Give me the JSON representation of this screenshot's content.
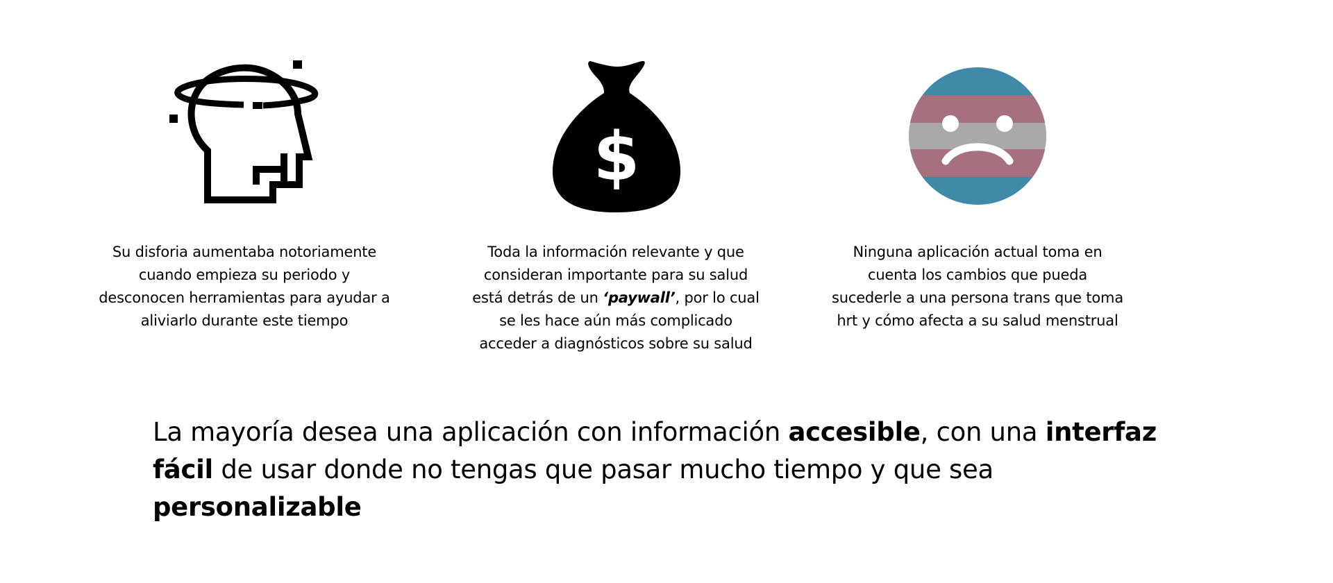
{
  "colors": {
    "text": "#000000",
    "background": "#ffffff",
    "trans_blue": "#3f8aa8",
    "trans_pink": "#a6707e",
    "trans_gray": "#a9a9a9"
  },
  "icons": [
    {
      "name": "head-dysphoria-icon"
    },
    {
      "name": "money-bag-icon"
    },
    {
      "name": "sad-face-trans-flag-icon"
    }
  ],
  "captions": {
    "first": "Su disforia aumentaba notoriamente cuando empieza su periodo y desconocen herramientas para ayudar a aliviarlo durante este tiempo",
    "second": {
      "before": "Toda la información relevante y que consideran importante para su salud está detrás de un ",
      "emphasis": "‘paywall’",
      "after": ", por lo cual se les hace aún más complicado acceder a diagnósticos sobre su salud"
    },
    "third": "Ninguna aplicación actual toma en cuenta los cambios que pueda sucederle a una persona trans que toma hrt y cómo afecta a su salud menstrual"
  },
  "statement": {
    "part1": "La mayoría desea una aplicación con información ",
    "bold1": "accesible",
    "part2": ", con una ",
    "bold2": "interfaz fácil",
    "part3": " de usar donde no tengas que pasar mucho tiempo y que sea ",
    "bold3": "personalizable"
  }
}
